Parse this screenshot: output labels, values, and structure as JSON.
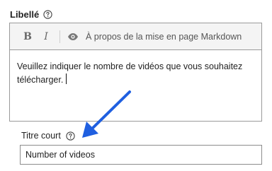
{
  "field": {
    "label": "Libellé",
    "help_icon": "help-circle-icon"
  },
  "toolbar": {
    "bold_label": "B",
    "italic_label": "I",
    "preview_icon": "eye-icon",
    "markdown_help": "À propos de la mise en page Markdown"
  },
  "editor": {
    "text": "Veuillez indiquer le nombre de vidéos que vous souhaitez télécharger."
  },
  "short_title": {
    "label": "Titre court",
    "help_icon": "help-circle-icon",
    "value": "Number of videos"
  },
  "annotation": {
    "arrow_icon": "blue-arrow-icon",
    "arrow_color": "#1f5fe0"
  }
}
